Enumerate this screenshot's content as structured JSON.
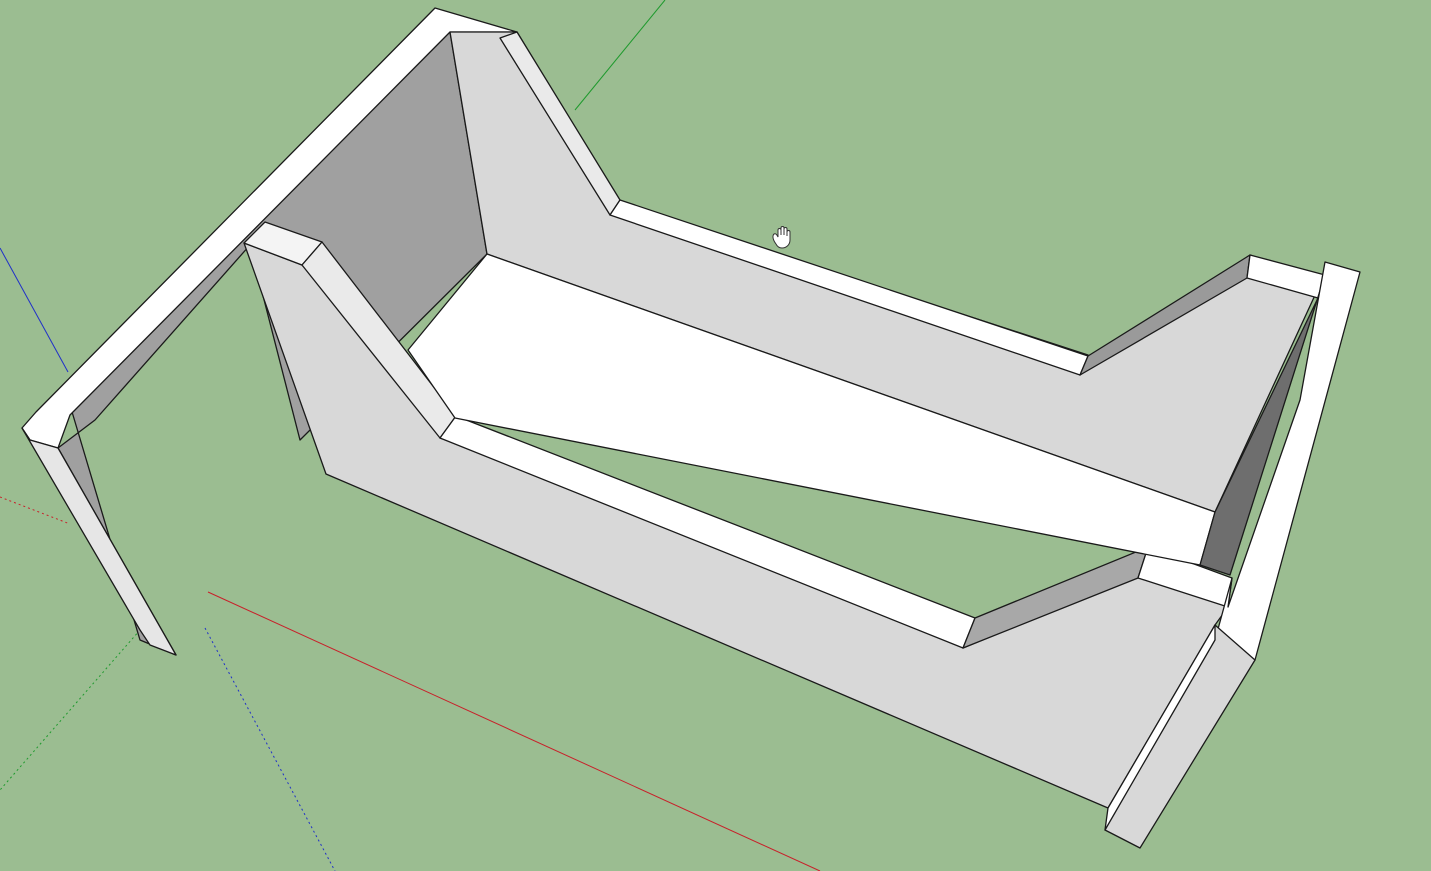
{
  "app": {
    "view": "3d-modeling-viewport",
    "tool_cursor": "pan-hand"
  },
  "colors": {
    "ground": "#9bbd91",
    "x_axis": "#c8202a",
    "y_axis": "#1f9a2e",
    "z_axis": "#2030c8",
    "face_top": "#ffffff",
    "face_light": "#d8d8d8",
    "face_mid": "#a0a0a0",
    "face_dark": "#707070",
    "edge": "#1a1a1a"
  }
}
